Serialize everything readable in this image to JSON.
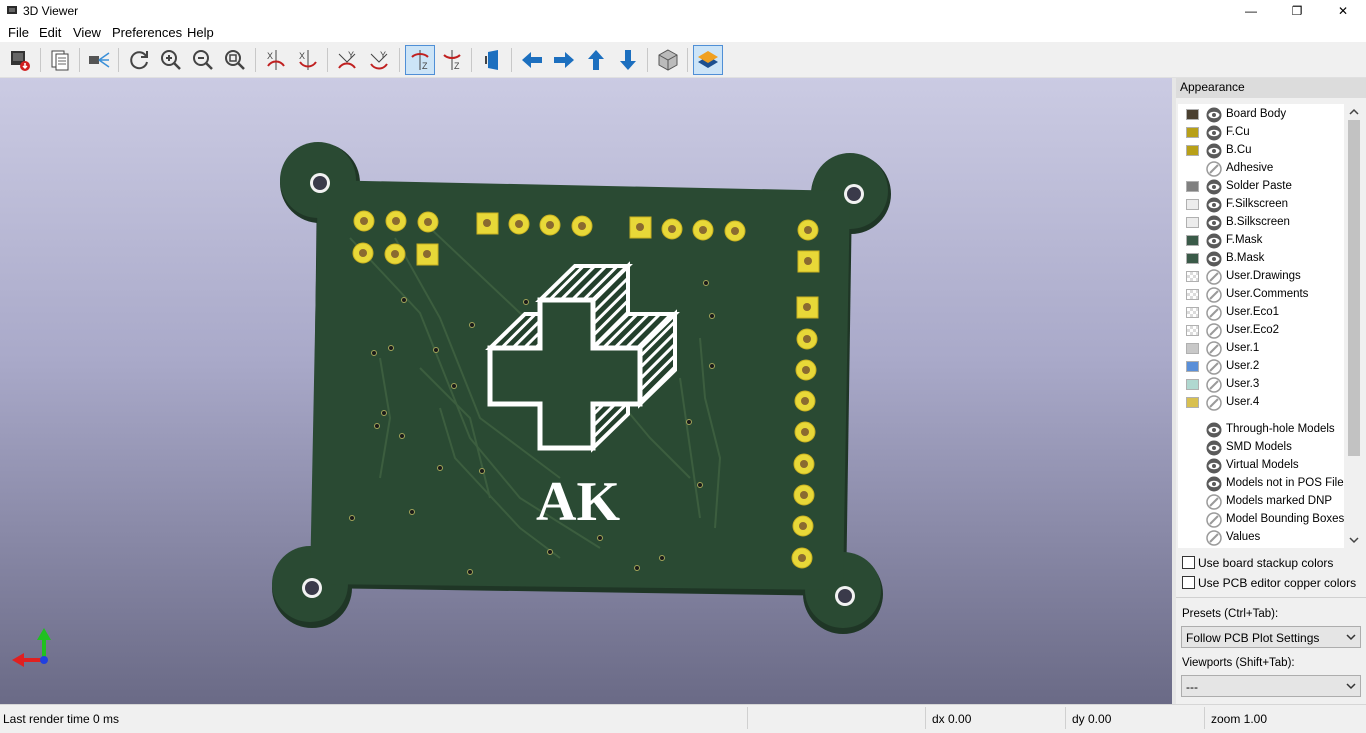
{
  "window": {
    "title": "3D Viewer",
    "minimize": "—",
    "maximize": "❐",
    "close": "✕"
  },
  "menu": [
    "File",
    "Edit",
    "View",
    "Preferences",
    "Help"
  ],
  "toolbar": {
    "buttons": [
      {
        "id": "render-export",
        "icon": "render-export-icon"
      },
      {
        "id": "copy-clipboard",
        "icon": "copy-icon"
      },
      {
        "id": "raytracing",
        "icon": "raytrace-icon"
      },
      {
        "id": "reload",
        "icon": "refresh-icon"
      },
      {
        "id": "zoom-in",
        "icon": "zoom-in-icon"
      },
      {
        "id": "zoom-out",
        "icon": "zoom-out-icon"
      },
      {
        "id": "zoom-fit",
        "icon": "zoom-fit-icon"
      },
      {
        "id": "rotate-x-cw",
        "icon": "rotate-x-icon"
      },
      {
        "id": "rotate-x-ccw",
        "icon": "rotate-x-icon"
      },
      {
        "id": "rotate-y-cw",
        "icon": "rotate-y-icon"
      },
      {
        "id": "rotate-y-ccw",
        "icon": "rotate-y-icon"
      },
      {
        "id": "rotate-z-cw",
        "icon": "rotate-z-icon",
        "active": true
      },
      {
        "id": "rotate-z-ccw",
        "icon": "rotate-z-icon"
      },
      {
        "id": "flip-board",
        "icon": "flip-board-icon"
      },
      {
        "id": "pan-left",
        "icon": "arrow-left-icon"
      },
      {
        "id": "pan-right",
        "icon": "arrow-right-icon"
      },
      {
        "id": "pan-up",
        "icon": "arrow-up-icon"
      },
      {
        "id": "pan-down",
        "icon": "arrow-down-icon"
      },
      {
        "id": "ortho",
        "icon": "cube-icon"
      },
      {
        "id": "layers-manager",
        "icon": "layers-icon",
        "active": true
      }
    ]
  },
  "board": {
    "silkscreen_text": "AK"
  },
  "appearance": {
    "title": "Appearance",
    "layers": [
      {
        "name": "Board Body",
        "color": "#4a4030",
        "visible": true
      },
      {
        "name": "F.Cu",
        "color": "#b8a018",
        "visible": true
      },
      {
        "name": "B.Cu",
        "color": "#b8a018",
        "visible": true
      },
      {
        "name": "Adhesive",
        "color": "",
        "visible": false
      },
      {
        "name": "Solder Paste",
        "color": "#808080",
        "visible": true
      },
      {
        "name": "F.Silkscreen",
        "color": "#ececec",
        "visible": true
      },
      {
        "name": "B.Silkscreen",
        "color": "#ececec",
        "visible": true
      },
      {
        "name": "F.Mask",
        "color": "#3a5a48",
        "visible": true
      },
      {
        "name": "B.Mask",
        "color": "#3a5a48",
        "visible": true
      },
      {
        "name": "User.Drawings",
        "color": "check",
        "visible": false
      },
      {
        "name": "User.Comments",
        "color": "check",
        "visible": false
      },
      {
        "name": "User.Eco1",
        "color": "check",
        "visible": false
      },
      {
        "name": "User.Eco2",
        "color": "check",
        "visible": false
      },
      {
        "name": "User.1",
        "color": "#c8c8c8",
        "visible": false
      },
      {
        "name": "User.2",
        "color": "#5a8fd8",
        "visible": false
      },
      {
        "name": "User.3",
        "color": "#b0d8d0",
        "visible": false
      },
      {
        "name": "User.4",
        "color": "#d8c050",
        "visible": false
      }
    ],
    "models": [
      {
        "name": "Through-hole Models",
        "visible": true
      },
      {
        "name": "SMD Models",
        "visible": true
      },
      {
        "name": "Virtual Models",
        "visible": true
      },
      {
        "name": "Models not in POS File",
        "visible": true
      },
      {
        "name": "Models marked DNP",
        "visible": false
      },
      {
        "name": "Model Bounding Boxes",
        "visible": false
      },
      {
        "name": "Values",
        "visible": false
      }
    ],
    "use_board_stackup_colors": "Use board stackup colors",
    "use_pcb_copper_colors": "Use PCB editor copper colors",
    "presets_label": "Presets (Ctrl+Tab):",
    "presets_value": "Follow PCB Plot Settings",
    "viewports_label": "Viewports (Shift+Tab):",
    "viewports_value": "---"
  },
  "status": {
    "render_time": "Last render time 0 ms",
    "dx": "dx 0.00",
    "dy": "dy 0.00",
    "zoom": "zoom 1.00"
  }
}
